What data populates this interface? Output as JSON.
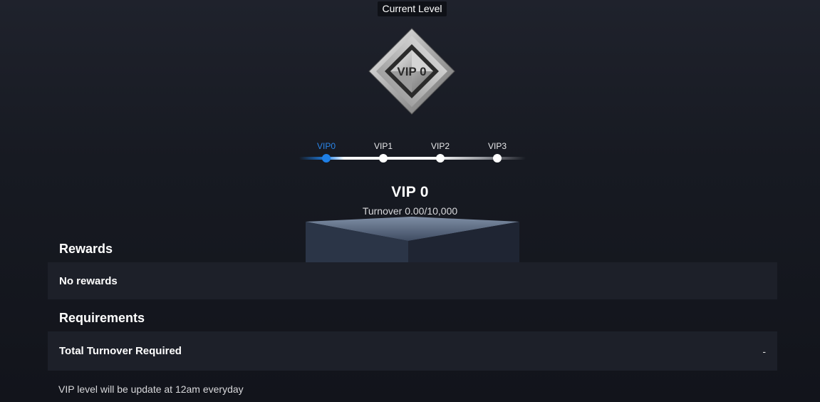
{
  "header": {
    "current_level_label": "Current Level"
  },
  "emblem": {
    "text": "VIP 0"
  },
  "progress": {
    "steps": [
      {
        "label": "VIP0",
        "active": true
      },
      {
        "label": "VIP1",
        "active": false
      },
      {
        "label": "VIP2",
        "active": false
      },
      {
        "label": "VIP3",
        "active": false
      }
    ]
  },
  "level": {
    "title": "VIP 0",
    "turnover": "Turnover 0.00/10,000"
  },
  "rewards": {
    "title": "Rewards",
    "content": "No rewards"
  },
  "requirements": {
    "title": "Requirements",
    "rows": [
      {
        "label": "Total Turnover Required",
        "value": "-"
      }
    ]
  },
  "footnote": "VIP level will be update at 12am everyday",
  "colors": {
    "accent": "#1e7fe6",
    "background": "#171a22",
    "panel": "#1d2029"
  }
}
